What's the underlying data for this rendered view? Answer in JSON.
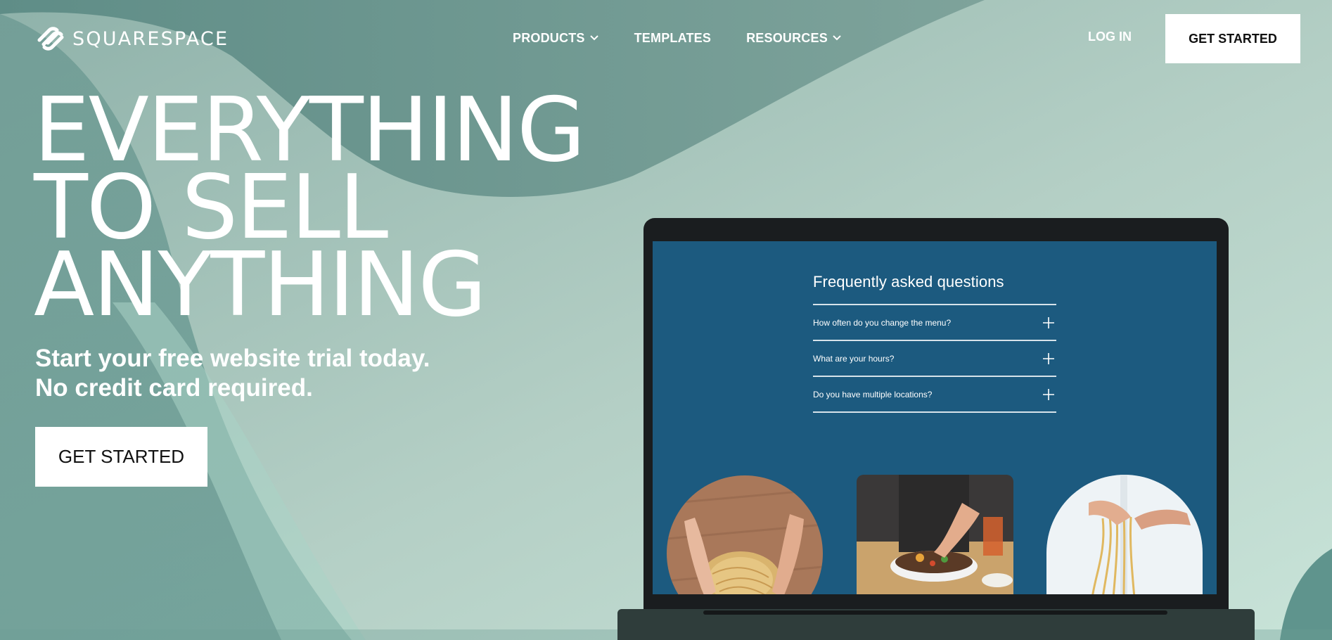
{
  "brand": {
    "name": "SQUARESPACE"
  },
  "nav": {
    "items": [
      {
        "label": "PRODUCTS",
        "has_dropdown": true
      },
      {
        "label": "TEMPLATES",
        "has_dropdown": false
      },
      {
        "label": "RESOURCES",
        "has_dropdown": true
      }
    ],
    "login_label": "LOG IN",
    "cta_label": "GET STARTED"
  },
  "hero": {
    "headline_lines": [
      "EVERYTHING",
      "TO SELL",
      "ANYTHING"
    ],
    "subheadline_lines": [
      "Start your free website trial today.",
      "No credit card required."
    ],
    "cta_label": "GET STARTED"
  },
  "laptop_preview": {
    "faq_title": "Frequently asked questions",
    "faq_items": [
      {
        "question": "How often do you change the menu?",
        "icon": "plus-icon"
      },
      {
        "question": "What are your hours?",
        "icon": "plus-icon"
      },
      {
        "question": "Do you have multiple locations?",
        "icon": "plus-icon"
      }
    ],
    "photos": [
      "noodle-hands-photo",
      "noodle-bowl-photo",
      "noodle-pull-photo"
    ]
  },
  "colors": {
    "background_teal": "#6f9a93",
    "background_mint": "#c3dfd5",
    "screen_blue": "#1c5a7f",
    "white": "#ffffff",
    "text_dark": "#111111"
  }
}
